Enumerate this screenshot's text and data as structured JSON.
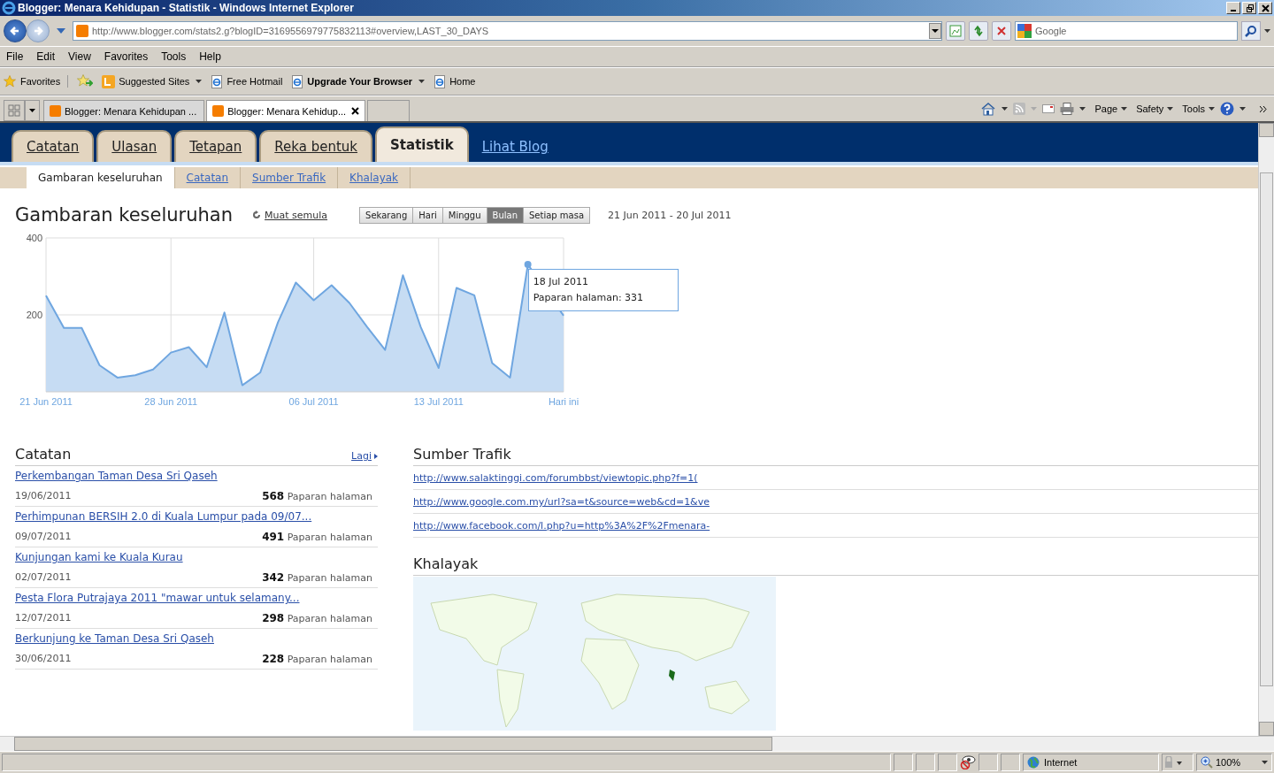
{
  "window": {
    "title": "Blogger: Menara Kehidupan - Statistik - Windows Internet Explorer"
  },
  "address_bar": {
    "url": "http://www.blogger.com/stats2.g?blogID=3169556979775832113#overview,LAST_30_DAYS",
    "search_placeholder": "Google"
  },
  "menu": [
    "File",
    "Edit",
    "View",
    "Favorites",
    "Tools",
    "Help"
  ],
  "favorites_bar": {
    "label": "Favorites",
    "items": [
      {
        "label": "Suggested Sites",
        "kind": "suggested",
        "bold": false,
        "dropdown": true
      },
      {
        "label": "Free Hotmail",
        "kind": "ie",
        "bold": false,
        "dropdown": false
      },
      {
        "label": "Upgrade Your Browser",
        "kind": "ie",
        "bold": true,
        "dropdown": true
      },
      {
        "label": "Home",
        "kind": "ie",
        "bold": false,
        "dropdown": false
      }
    ]
  },
  "browser_tabs": [
    {
      "title": "Blogger: Menara Kehidupan ...",
      "selected": false
    },
    {
      "title": "Blogger: Menara Kehidup...",
      "selected": true
    }
  ],
  "command_bar": [
    "Page",
    "Safety",
    "Tools"
  ],
  "blog_tabs": [
    {
      "label": "Catatan",
      "selected": false
    },
    {
      "label": "Ulasan",
      "selected": false
    },
    {
      "label": "Tetapan",
      "selected": false
    },
    {
      "label": "Reka bentuk",
      "selected": false
    },
    {
      "label": "Statistik",
      "selected": true
    }
  ],
  "view_blog": "Lihat Blog",
  "sub_tabs": [
    {
      "label": "Gambaran keseluruhan",
      "selected": true
    },
    {
      "label": "Catatan",
      "selected": false
    },
    {
      "label": "Sumber Trafik",
      "selected": false
    },
    {
      "label": "Khalayak",
      "selected": false
    }
  ],
  "overview": {
    "title": "Gambaran keseluruhan",
    "reload": "Muat semula",
    "ranges": [
      {
        "label": "Sekarang",
        "selected": false
      },
      {
        "label": "Hari",
        "selected": false
      },
      {
        "label": "Minggu",
        "selected": false
      },
      {
        "label": "Bulan",
        "selected": true
      },
      {
        "label": "Setiap masa",
        "selected": false
      }
    ],
    "date_range": "21 Jun 2011 - 20 Jul 2011",
    "tooltip": {
      "date": "18 Jul 2011",
      "text": "Paparan halaman: 331"
    },
    "chart_data": {
      "type": "area",
      "categories": [
        "21 Jun 2011",
        null,
        null,
        null,
        null,
        null,
        null,
        "28 Jun 2011",
        null,
        null,
        null,
        null,
        null,
        null,
        null,
        "06 Jul 2011",
        null,
        null,
        null,
        null,
        null,
        null,
        "13 Jul 2011",
        null,
        null,
        null,
        null,
        null,
        null,
        "Hari ini"
      ],
      "series": [
        {
          "color": "#6fa6e0",
          "values": [
            250,
            166,
            166,
            69,
            37,
            43,
            58,
            102,
            116,
            64,
            206,
            17,
            50,
            181,
            284,
            238,
            277,
            231,
            168,
            109,
            303,
            168,
            62,
            270,
            251,
            75,
            37,
            331,
            null,
            198
          ]
        }
      ],
      "ylim": [
        0,
        400
      ],
      "yticks": [
        200,
        400
      ],
      "grid": true
    }
  },
  "posts": {
    "title": "Catatan",
    "more": "Lagi",
    "items": [
      {
        "title": "Perkembangan Taman Desa Sri Qaseh",
        "date": "19/06/2011",
        "views": "568",
        "unit": "Paparan halaman"
      },
      {
        "title": "Perhimpunan BERSIH 2.0  di Kuala Lumpur pada 09/07...",
        "date": "09/07/2011",
        "views": "491",
        "unit": "Paparan halaman"
      },
      {
        "title": "Kunjungan kami ke Kuala Kurau",
        "date": "02/07/2011",
        "views": "342",
        "unit": "Paparan halaman"
      },
      {
        "title": "Pesta Flora Putrajaya 2011   \"mawar untuk selamany...",
        "date": "12/07/2011",
        "views": "298",
        "unit": "Paparan halaman"
      },
      {
        "title": "Berkunjung ke Taman Desa Sri Qaseh",
        "date": "30/06/2011",
        "views": "228",
        "unit": "Paparan halaman"
      }
    ]
  },
  "traffic": {
    "title": "Sumber Trafik",
    "links": [
      "http://www.salaktinggi.com/forumbbst/viewtopic.php?f=1(",
      "http://www.google.com.my/url?sa=t&source=web&cd=1&ve",
      "http://www.facebook.com/l.php?u=http%3A%2F%2Fmenara-"
    ]
  },
  "audience": {
    "title": "Khalayak"
  },
  "status_bar": {
    "zone": "Internet",
    "zoom": "100%"
  }
}
